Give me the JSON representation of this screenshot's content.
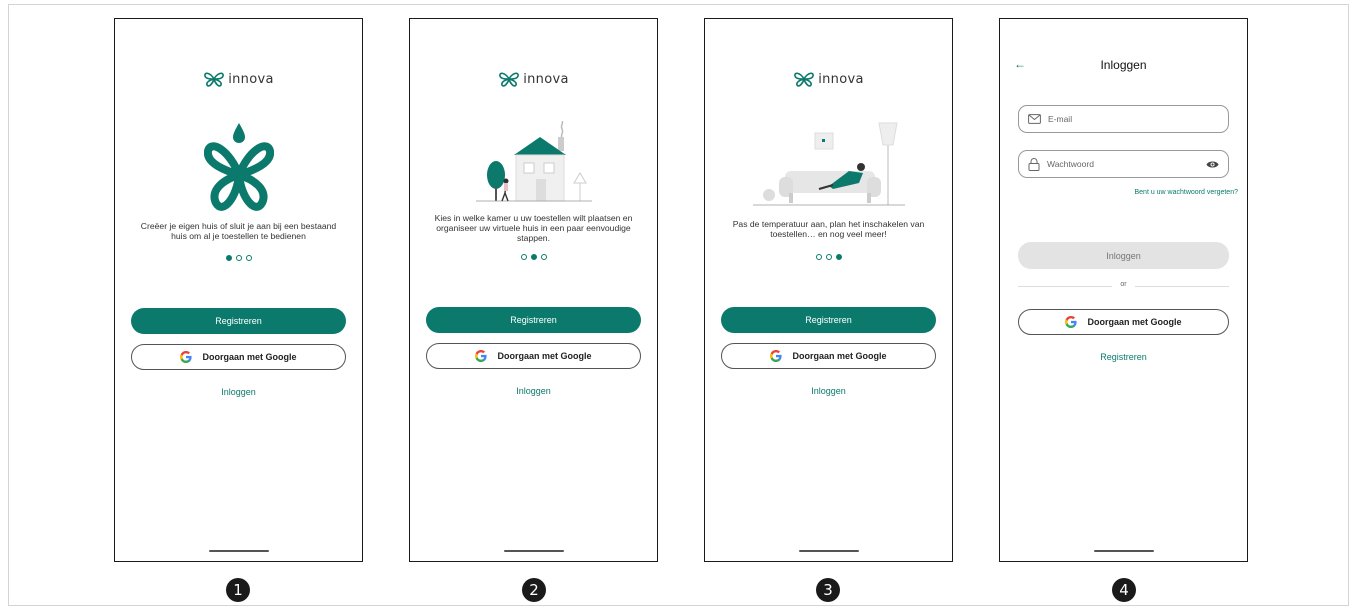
{
  "brand": {
    "name": "innova",
    "accent": "#0b7a6c"
  },
  "screens": [
    {
      "step": "1",
      "description": "Creëer je eigen huis of sluit je aan bij een bestaand huis om al je toestellen te bedienen",
      "active_dot": 0,
      "register_label": "Registreren",
      "google_label": "Doorgaan met Google",
      "login_link": "Inloggen"
    },
    {
      "step": "2",
      "description": "Kies in welke kamer u uw toestellen wilt plaatsen en organiseer uw virtuele huis in een paar eenvoudige stappen.",
      "active_dot": 1,
      "register_label": "Registreren",
      "google_label": "Doorgaan met Google",
      "login_link": "Inloggen"
    },
    {
      "step": "3",
      "description": "Pas de temperatuur aan, plan het inschakelen van toestellen… en nog veel meer!",
      "active_dot": 2,
      "register_label": "Registreren",
      "google_label": "Doorgaan met Google",
      "login_link": "Inloggen"
    }
  ],
  "login_screen": {
    "step": "4",
    "title": "Inloggen",
    "email_placeholder": "E-mail",
    "password_placeholder": "Wachtwoord",
    "forgot_link": "Bent u uw wachtwoord vergeten?",
    "login_button": "Inloggen",
    "divider_text": "or",
    "google_label": "Doorgaan met Google",
    "register_link": "Registreren"
  }
}
